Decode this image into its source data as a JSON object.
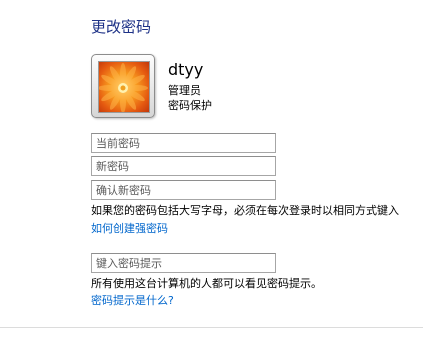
{
  "page": {
    "title": "更改密码"
  },
  "user": {
    "name": "dtyy",
    "role": "管理员",
    "status": "密码保护"
  },
  "fields": {
    "current_password_placeholder": "当前密码",
    "new_password_placeholder": "新密码",
    "confirm_password_placeholder": "确认新密码",
    "password_hint_placeholder": "键入密码提示"
  },
  "notes": {
    "caps_warning": "如果您的密码包括大写字母，必须在每次登录时以相同方式键入",
    "hint_visibility": "所有使用这台计算机的人都可以看见密码提示。"
  },
  "links": {
    "strong_password": "如何创建强密码",
    "what_is_hint": "密码提示是什么?"
  },
  "colors": {
    "title": "#1e3287",
    "link": "#0066cc",
    "field_border": "#a6a6a6"
  },
  "icons": {
    "avatar": "orange-flower-user-picture"
  }
}
